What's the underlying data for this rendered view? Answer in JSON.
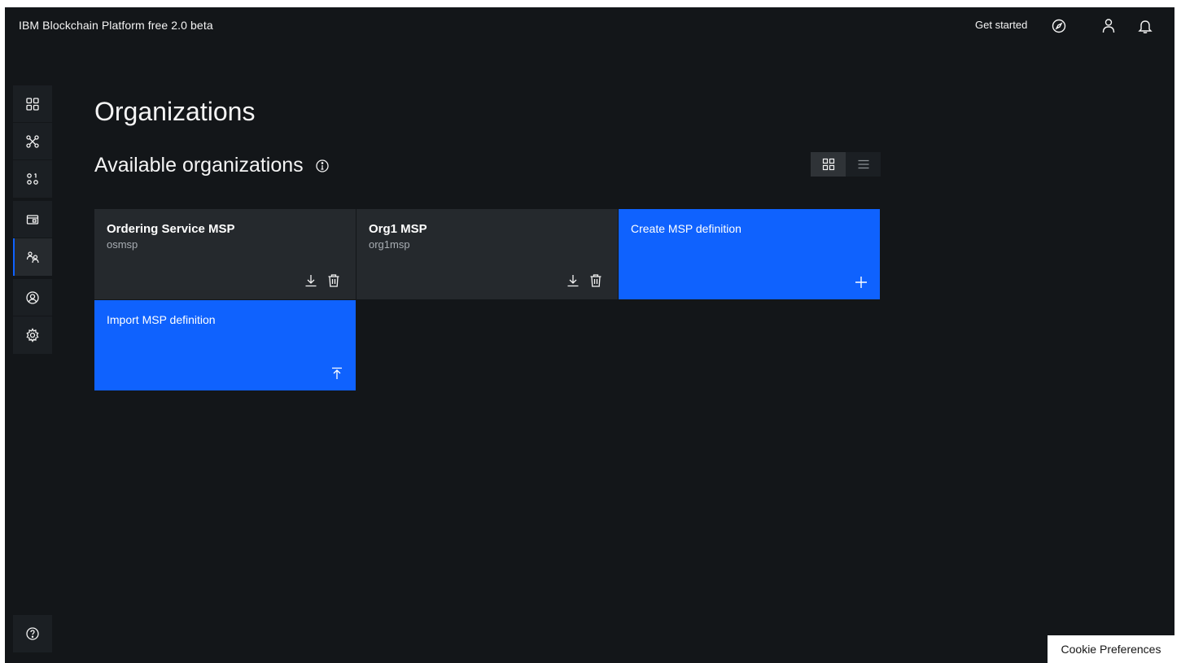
{
  "header": {
    "app_title": "IBM Blockchain Platform free 2.0 beta",
    "get_started": "Get started",
    "icons": [
      "compass-icon",
      "user-icon",
      "notification-icon"
    ]
  },
  "nav": {
    "items": [
      {
        "name": "dashboard-icon",
        "active": false
      },
      {
        "name": "network-icon",
        "active": false
      },
      {
        "name": "nodes-icon",
        "active": false
      },
      {
        "name": "wallet-icon",
        "active": false
      },
      {
        "name": "organizations-icon",
        "active": true
      },
      {
        "name": "users-icon",
        "active": false
      },
      {
        "name": "settings-icon",
        "active": false
      },
      {
        "name": "help-icon",
        "active": false
      }
    ]
  },
  "main": {
    "page_title": "Organizations",
    "section_title": "Available organizations",
    "view_toggle": {
      "selected": "grid"
    }
  },
  "tiles": [
    {
      "name": "Ordering Service MSP",
      "msp_id": "osmsp"
    },
    {
      "name": "Org1 MSP",
      "msp_id": "org1msp"
    }
  ],
  "actions": {
    "create": "Create MSP definition",
    "import": "Import MSP definition"
  },
  "cookie": {
    "label": "Cookie Preferences"
  },
  "colors": {
    "background": "#131619",
    "tile": "#25292d",
    "accent": "#0f62fe"
  }
}
